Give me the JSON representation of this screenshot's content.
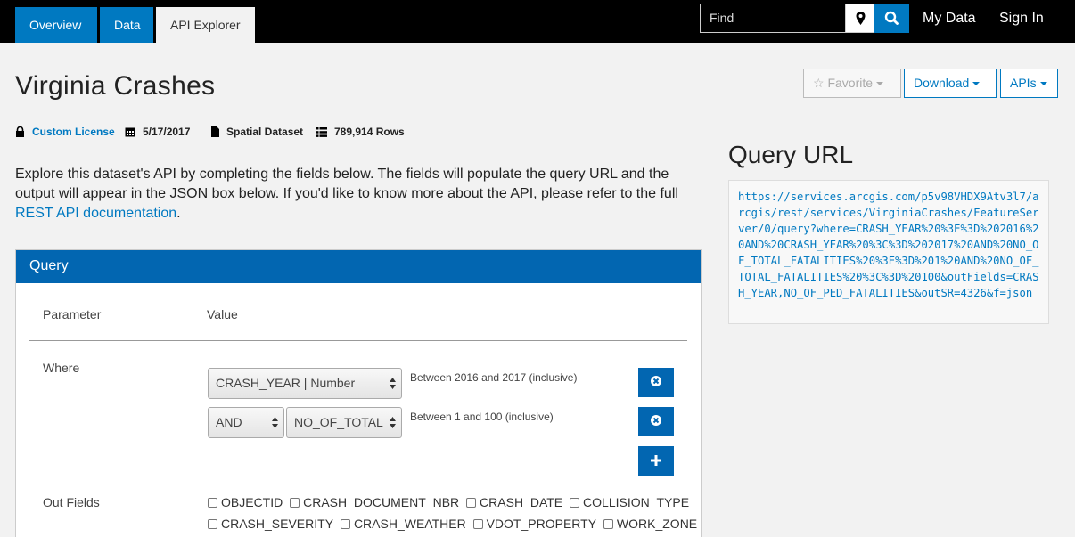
{
  "nav": {
    "tabs": [
      {
        "label": "Overview"
      },
      {
        "label": "Data"
      },
      {
        "label": "API Explorer"
      }
    ],
    "search_placeholder": "Find",
    "my_data": "My Data",
    "sign_in": "Sign In"
  },
  "dataset": {
    "title": "Virginia Crashes",
    "favorite_label": "Favorite",
    "download_label": "Download",
    "apis_label": "APIs",
    "license": "Custom License",
    "date": "5/17/2017",
    "type": "Spatial Dataset",
    "rows": "789,914 Rows"
  },
  "description": {
    "text": "Explore this dataset's API by completing the fields below. The fields will populate the query URL and the output will appear in the JSON box below. If you'd like to know more about the API, please refer to the full ",
    "link": "REST API documentation",
    "end": "."
  },
  "query": {
    "title": "Query",
    "param_header": "Parameter",
    "value_header": "Value",
    "where_label": "Where",
    "cond1": {
      "field": "CRASH_YEAR | Number",
      "hint": "Between 2016 and 2017 (inclusive)"
    },
    "cond2": {
      "op": "AND",
      "field": "NO_OF_TOTAL",
      "hint": "Between 1 and 100 (inclusive)"
    },
    "outfields_label": "Out Fields",
    "outfields_row1": [
      "OBJECTID",
      "CRASH_DOCUMENT_NBR",
      "CRASH_DATE",
      "COLLISION_TYPE"
    ],
    "outfields_row2": [
      "CRASH_SEVERITY",
      "CRASH_WEATHER",
      "VDOT_PROPERTY",
      "WORK_ZONE"
    ]
  },
  "query_url": {
    "title": "Query URL",
    "url": "https://services.arcgis.com/p5v98VHDX9Atv3l7/arcgis/rest/services/VirginiaCrashes/FeatureServer/0/query?where=CRASH_YEAR%20%3E%3D%202016%20AND%20CRASH_YEAR%20%3C%3D%202017%20AND%20NO_OF_TOTAL_FATALITIES%20%3E%3D%201%20AND%20NO_OF_TOTAL_FATALITIES%20%3C%3D%20100&outFields=CRASH_YEAR,NO_OF_PED_FATALITIES&outSR=4326&f=json"
  },
  "colors": {
    "accent": "#0079c1",
    "header_blue": "#0266b1",
    "topbar": "#000000"
  }
}
